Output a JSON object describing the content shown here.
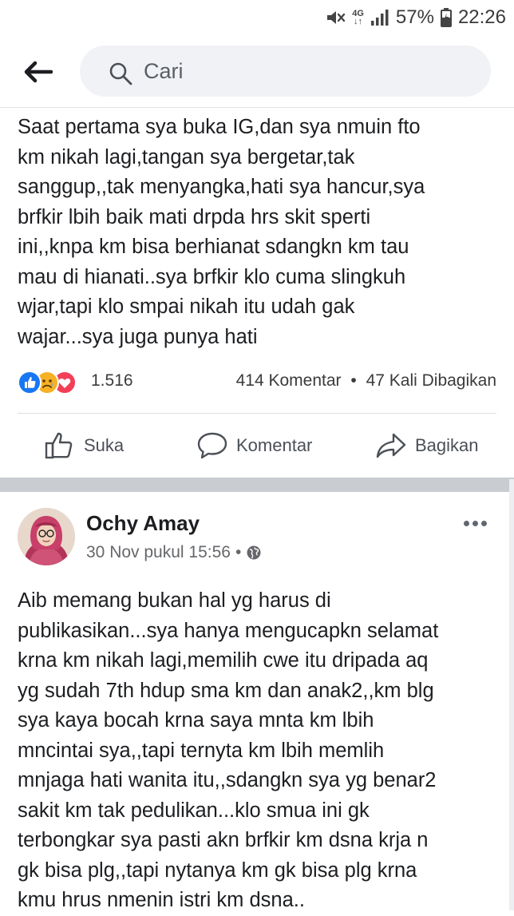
{
  "status_bar": {
    "network_type": "4G",
    "battery": "57%",
    "time": "22:26",
    "icons": [
      "mute-icon",
      "signal-icon",
      "battery-icon"
    ]
  },
  "search": {
    "placeholder": "Cari",
    "back_icon": "back-arrow-icon",
    "search_icon": "search-icon"
  },
  "post1": {
    "text": "Saat pertama sya buka IG,dan sya nmuin fto\nkm nikah lagi,tangan sya bergetar,tak\nsanggup,,tak menyangka,hati sya hancur,sya\nbrfkir lbih baik mati drpda hrs skit sperti\nini,,knpa km bisa berhianat sdangkn km tau\nmau di hianati..sya brfkir klo cuma slingkuh\nwjar,tapi klo smpai nikah itu udah gak\nwajar...sya juga punya hati",
    "reaction_icons": [
      "like-reaction-icon",
      "sad-reaction-icon",
      "love-reaction-icon"
    ],
    "reaction_count": "1.516",
    "comments": "414 Komentar",
    "shares": "47 Kali Dibagikan",
    "dot": "•"
  },
  "actions": {
    "like": "Suka",
    "comment": "Komentar",
    "share": "Bagikan"
  },
  "post2": {
    "author": "Ochy Amay",
    "timestamp": "30 Nov pukul 15:56",
    "dot": "•",
    "audience_icon": "globe-icon",
    "text": "Aib memang bukan hal yg harus di\npublikasikan...sya hanya mengucapkn selamat\nkrna km nikah lagi,memilih cwe itu dripada aq\nyg sudah 7th hdup sma km dan anak2,,km blg\nsya kaya bocah krna saya mnta km lbih\nmncintai sya,,tapi ternyta km lbih memlih\nmnjaga hati wanita itu,,sdangkn sya yg benar2\nsakit km tak pedulikan...klo smua ini gk\nterbongkar sya pasti akn brfkir km dsna krja n\ngk bisa plg,,tapi nytanya km gk bisa plg krna\nkmu hrus nmenin istri km dsna.."
  },
  "colors": {
    "facebook_blue": "#1877f2",
    "like_blue": "#1877f2",
    "love_red": "#f33e58",
    "sad_yellow": "#f7b125",
    "separator": "#c9ccd1"
  }
}
